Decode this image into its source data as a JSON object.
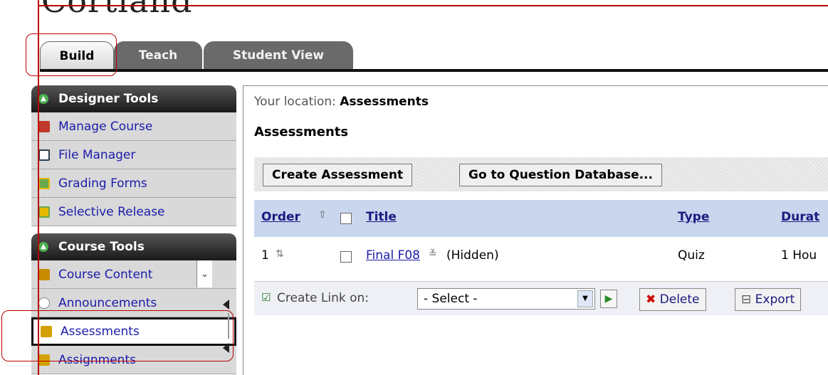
{
  "brand": {
    "logo_text": "Cortland"
  },
  "tabs": [
    {
      "label": "Build"
    },
    {
      "label": "Teach"
    },
    {
      "label": "Student View"
    }
  ],
  "sidebar": {
    "designer": {
      "title": "Designer Tools",
      "items": [
        {
          "label": "Manage Course",
          "icon": "manage-course-icon",
          "color": "#c0392b"
        },
        {
          "label": "File Manager",
          "icon": "file-manager-icon",
          "color": "#2c3e50"
        },
        {
          "label": "Grading Forms",
          "icon": "grading-forms-icon",
          "color": "#6aa84f"
        },
        {
          "label": "Selective Release",
          "icon": "selective-release-icon",
          "color": "#e6b800"
        }
      ]
    },
    "course": {
      "title": "Course Tools",
      "items": [
        {
          "label": "Course Content",
          "icon": "home-icon",
          "color": "#c78a00"
        },
        {
          "label": "Announcements",
          "icon": "announcements-icon",
          "color": "#888888"
        },
        {
          "label": "Assessments",
          "icon": "assessments-icon",
          "color": "#d4a000"
        },
        {
          "label": "Assignments",
          "icon": "assignments-icon",
          "color": "#d4a000"
        }
      ]
    }
  },
  "main": {
    "location_label": "Your location:",
    "location_value": "Assessments",
    "page_title": "Assessments",
    "buttons": {
      "create": "Create Assessment",
      "question_db": "Go to Question Database..."
    },
    "table": {
      "headers": {
        "order": "Order",
        "title": "Title",
        "type": "Type",
        "duration": "Durat"
      },
      "rows": [
        {
          "order": "1",
          "title": "Final F08",
          "status": "(Hidden)",
          "type": "Quiz",
          "duration": "1 Hou"
        }
      ]
    },
    "actions": {
      "create_link_label": "Create Link on:",
      "select_value": "- Select -",
      "delete_label": "Delete",
      "export_label": "Export"
    }
  },
  "colors": {
    "annotation_red": "#b00000",
    "link": "#1b1bab",
    "header_bg": "#c9d6ee"
  }
}
